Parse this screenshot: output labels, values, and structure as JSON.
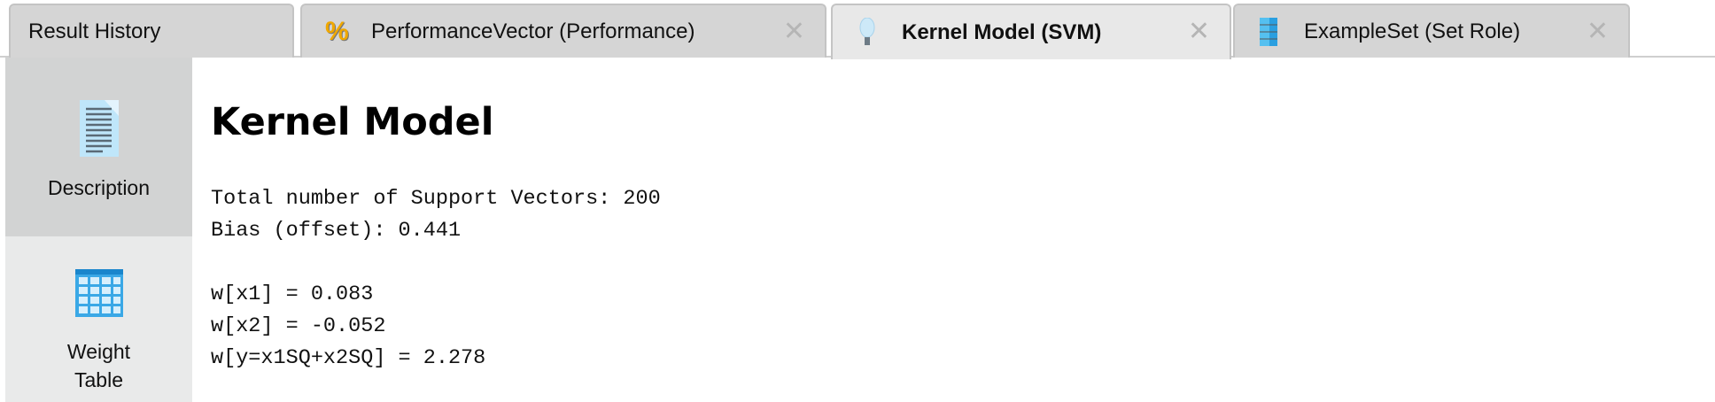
{
  "tabs": [
    {
      "label": "Result History",
      "icon": "none",
      "closable": false,
      "active": false
    },
    {
      "label": "PerformanceVector (Performance)",
      "icon": "percent-icon",
      "closable": true,
      "active": false
    },
    {
      "label": "Kernel Model (SVM)",
      "icon": "lightbulb-icon",
      "closable": true,
      "active": true
    },
    {
      "label": "ExampleSet (Set Role)",
      "icon": "exampleset-icon",
      "closable": true,
      "active": false
    }
  ],
  "close_glyph": "✕",
  "sidebar": {
    "items": [
      {
        "label": "Description",
        "icon": "document-icon",
        "selected": true
      },
      {
        "label_line1": "Weight",
        "label_line2": "Table",
        "icon": "table-icon",
        "selected": false
      }
    ]
  },
  "main": {
    "title": "Kernel Model",
    "lines": [
      "Total number of Support Vectors: 200",
      "Bias (offset): 0.441",
      "",
      "w[x1] = 0.083",
      "w[x2] = -0.052",
      "w[y=x1SQ+x2SQ] = 2.278"
    ]
  },
  "colors": {
    "accent_blue": "#2a9fe0",
    "percent_orange": "#f0a800"
  }
}
